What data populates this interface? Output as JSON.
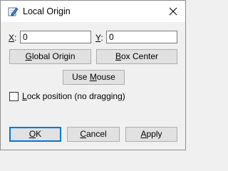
{
  "window": {
    "title": "Local Origin"
  },
  "fields": {
    "x": {
      "label_key": "X",
      "label_rest": ":",
      "value": "0"
    },
    "y": {
      "label_key": "Y",
      "label_rest": ":",
      "value": "0"
    }
  },
  "buttons": {
    "global_origin": {
      "key": "G",
      "rest": "lobal Origin"
    },
    "box_center": {
      "key": "B",
      "rest": "ox Center"
    },
    "use_mouse": {
      "pre": "Use ",
      "key": "M",
      "rest": "ouse"
    },
    "ok": {
      "key": "O",
      "rest": "K"
    },
    "cancel": {
      "pre": "",
      "key": "C",
      "rest": "ancel"
    },
    "apply": {
      "key": "A",
      "rest": "pply"
    }
  },
  "lock": {
    "key": "L",
    "rest": "ock position (no dragging)",
    "checked": false
  },
  "icons": {
    "app": "pencil-paper-icon",
    "close": "close-icon"
  }
}
